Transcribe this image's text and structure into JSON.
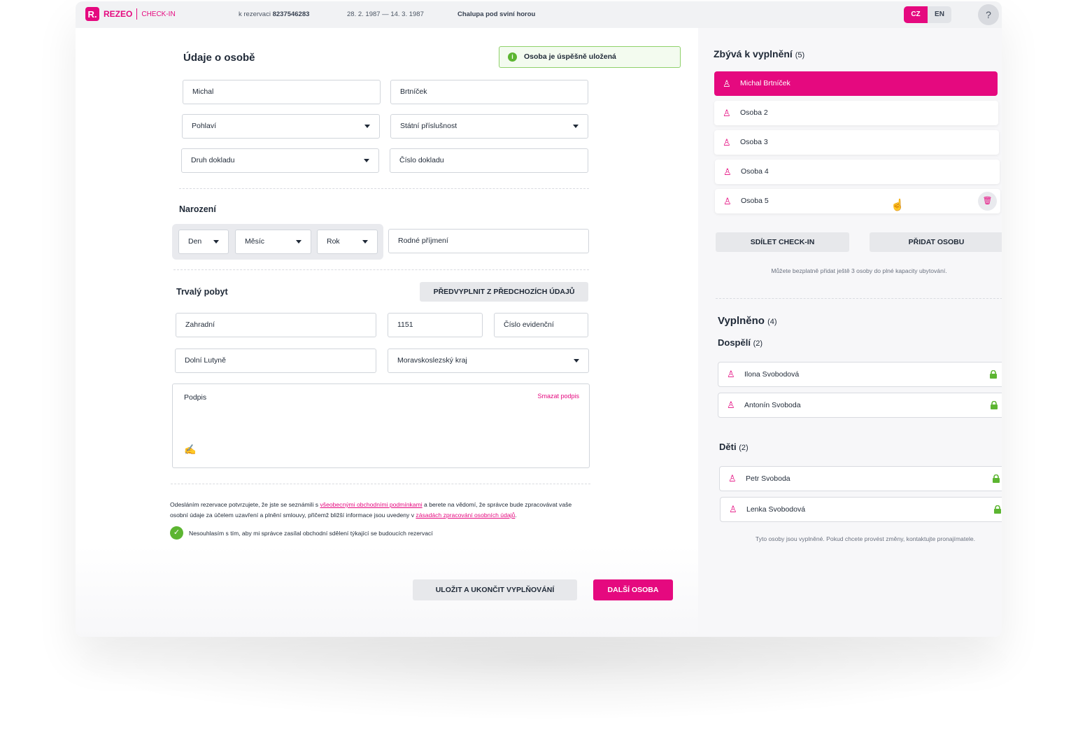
{
  "topbar": {
    "logo_mark": "R.",
    "logo_text": "REZEO",
    "logo_sub": "CHECK-IN",
    "reservation_prefix": "k rezervaci",
    "reservation_number": "8237546283",
    "dates": "28. 2. 1987 — 14. 3. 1987",
    "property": "Chalupa pod sviní horou",
    "lang_cz": "CZ",
    "lang_en": "EN",
    "help": "?"
  },
  "form": {
    "title": "Údaje o osobě",
    "toast": "Osoba je úspěšně uložená",
    "first_name": "Michal",
    "last_name": "Brtníček",
    "gender": "Pohlaví",
    "nationality": "Státní příslušnost",
    "doc_type": "Druh dokladu",
    "doc_number": "Číslo dokladu",
    "birth_title": "Narození",
    "day": "Den",
    "month": "Měsíc",
    "year": "Rok",
    "birth_surname": "Rodné příjmení",
    "residence_title": "Trvalý pobyt",
    "prefill_button": "PŘEDVYPLNIT Z PŘEDCHOZÍCH ÚDAJŮ",
    "street": "Zahradní",
    "house_number": "1151",
    "evidence_number": "Číslo evidenční",
    "city": "Dolní Lutyně",
    "region": "Moravskoslezský kraj",
    "signature_label": "Podpis",
    "signature_clear": "Smazat podpis",
    "legal_1": "Odesláním rezervace potvrzujete, že jste se seznámili s",
    "legal_link_1": "všeobecnými obchodními podmínkami",
    "legal_2": "a berete na vědomí, že správce bude zpracovávat vaše osobní údaje za účelem uzavření a plnění smlouvy, přičemž bližší informace jsou uvedeny v",
    "legal_link_2": "zásadách zpracování osobních údajů",
    "legal_3": ".",
    "consent": "Nesouhlasím s tím, aby mi správce zasílal obchodní sdělení týkající se budoucích rezervací",
    "save_button": "ULOŽIT A UKONČIT VYPLŇOVÁNÍ",
    "next_button": "DALŠÍ OSOBA"
  },
  "sidebar": {
    "remaining_title": "Zbývá k vyplnění",
    "remaining_count": "(5)",
    "remaining": [
      {
        "name": "Michal Brtníček"
      },
      {
        "name": "Osoba 2"
      },
      {
        "name": "Osoba 3"
      },
      {
        "name": "Osoba 4"
      },
      {
        "name": "Osoba 5"
      }
    ],
    "share_button": "SDÍLET CHECK-IN",
    "add_button": "PŘIDAT OSOBU",
    "capacity_note": "Můžete bezplatně přidat ještě 3 osoby do plné kapacity ubytování.",
    "filled_title": "Vyplněno",
    "filled_count": "(4)",
    "adults_title": "Dospělí",
    "adults_count": "(2)",
    "adults": [
      {
        "name": "Ilona Svobodová"
      },
      {
        "name": "Antonín Svoboda"
      }
    ],
    "children_title": "Děti",
    "children_count": "(2)",
    "children": [
      {
        "name": "Petr Svoboda"
      },
      {
        "name": "Lenka Svobodová"
      }
    ],
    "filled_note": "Tyto osoby jsou vyplněné. Pokud chcete provést změny, kontaktujte pronajímatele."
  },
  "colors": {
    "accent": "#e5097f",
    "success": "#5cb531"
  }
}
